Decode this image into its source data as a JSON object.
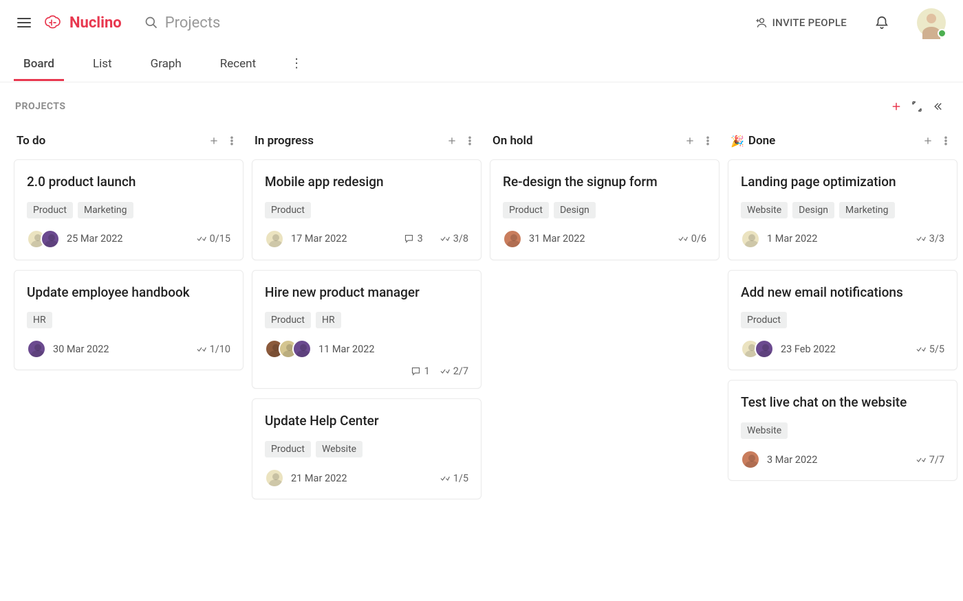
{
  "app": {
    "name": "Nuclino"
  },
  "search": {
    "placeholder": "Projects"
  },
  "header": {
    "invite": "INVITE PEOPLE"
  },
  "tabs": [
    "Board",
    "List",
    "Graph",
    "Recent"
  ],
  "activeTab": 0,
  "breadcrumb": "PROJECTS",
  "columns": [
    {
      "title": "To do",
      "emoji": "",
      "cards": [
        {
          "title": "2.0 product launch",
          "tags": [
            "Product",
            "Marketing"
          ],
          "avatars": [
            "av1",
            "av2"
          ],
          "date": "25 Mar 2022",
          "comments": null,
          "checks": "0/15"
        },
        {
          "title": "Update employee handbook",
          "tags": [
            "HR"
          ],
          "avatars": [
            "av2"
          ],
          "date": "30 Mar 2022",
          "comments": null,
          "checks": "1/10"
        }
      ]
    },
    {
      "title": "In progress",
      "emoji": "",
      "cards": [
        {
          "title": "Mobile app redesign",
          "tags": [
            "Product"
          ],
          "avatars": [
            "av1"
          ],
          "date": "17 Mar 2022",
          "comments": "3",
          "checks": "3/8"
        },
        {
          "title": "Hire new product manager",
          "tags": [
            "Product",
            "HR"
          ],
          "avatars": [
            "av3",
            "av5",
            "av2"
          ],
          "date": "11 Mar 2022",
          "comments": "1",
          "checks": "2/7",
          "wrap": true
        },
        {
          "title": "Update Help Center",
          "tags": [
            "Product",
            "Website"
          ],
          "avatars": [
            "av1"
          ],
          "date": "21 Mar 2022",
          "comments": null,
          "checks": "1/5"
        }
      ]
    },
    {
      "title": "On hold",
      "emoji": "",
      "cards": [
        {
          "title": "Re-design the signup form",
          "tags": [
            "Product",
            "Design"
          ],
          "avatars": [
            "av4"
          ],
          "date": "31 Mar 2022",
          "comments": null,
          "checks": "0/6"
        }
      ]
    },
    {
      "title": "Done",
      "emoji": "🎉",
      "cards": [
        {
          "title": "Landing page optimization",
          "tags": [
            "Website",
            "Design",
            "Marketing"
          ],
          "avatars": [
            "av1"
          ],
          "date": "1 Mar 2022",
          "comments": null,
          "checks": "3/3"
        },
        {
          "title": "Add new email notifications",
          "tags": [
            "Product"
          ],
          "avatars": [
            "av1",
            "av2"
          ],
          "date": "23 Feb 2022",
          "comments": null,
          "checks": "5/5"
        },
        {
          "title": "Test live chat on the website",
          "tags": [
            "Website"
          ],
          "avatars": [
            "av4"
          ],
          "date": "3 Mar 2022",
          "comments": null,
          "checks": "7/7"
        }
      ]
    }
  ]
}
